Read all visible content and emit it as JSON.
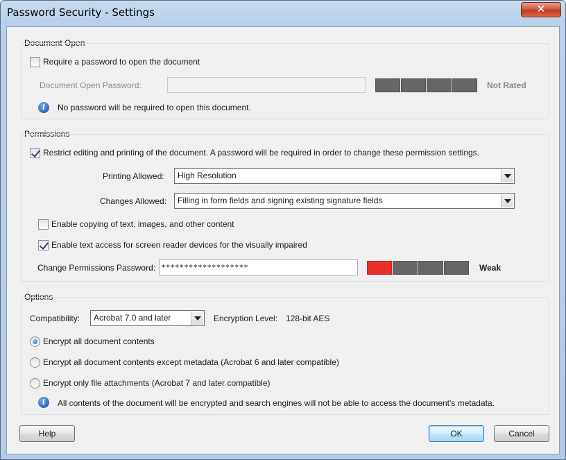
{
  "window": {
    "title": "Password Security - Settings",
    "close_glyph": "✕"
  },
  "document_open": {
    "section_title": "Document Open",
    "require_label": "Require a password to open the document",
    "require_checked": false,
    "password_label": "Document Open Password:",
    "password_value": "",
    "strength_label": "Not Rated",
    "strength_segments": 4,
    "strength_level": 0,
    "info_text": "No password will be required to open this document."
  },
  "permissions": {
    "section_title": "Permissions",
    "restrict_label": "Restrict editing and printing of the document. A password will be required in order to change these permission settings.",
    "restrict_checked": true,
    "printing_label": "Printing Allowed:",
    "printing_value": "High Resolution",
    "changes_label": "Changes Allowed:",
    "changes_value": "Filling in form fields and signing existing signature fields",
    "copy_label": "Enable copying of text, images, and other content",
    "copy_checked": false,
    "screen_reader_label": "Enable text access for screen reader devices for the visually impaired",
    "screen_reader_checked": true,
    "password_label": "Change Permissions Password:",
    "password_value": "*******************",
    "strength_label": "Weak",
    "strength_segments": 4,
    "strength_level": 1,
    "colors": {
      "weak": "#e8302c",
      "empty": "#666666"
    }
  },
  "options": {
    "section_title": "Options",
    "compat_label": "Compatibility:",
    "compat_value": "Acrobat 7.0 and later",
    "encryption_label": "Encryption  Level:",
    "encryption_value": "128-bit AES",
    "radio_all": "Encrypt all document contents",
    "radio_except": "Encrypt all document contents except metadata (Acrobat 6 and later compatible)",
    "radio_attach": "Encrypt only file attachments (Acrobat 7 and later compatible)",
    "selected": "all",
    "info_text": "All contents of the document will be encrypted and search engines will not be able to access the document's metadata."
  },
  "buttons": {
    "help": "Help",
    "ok": "OK",
    "cancel": "Cancel"
  },
  "icons": {
    "info": "info-icon",
    "close": "close-icon",
    "dropdown": "chevron-down-icon"
  }
}
